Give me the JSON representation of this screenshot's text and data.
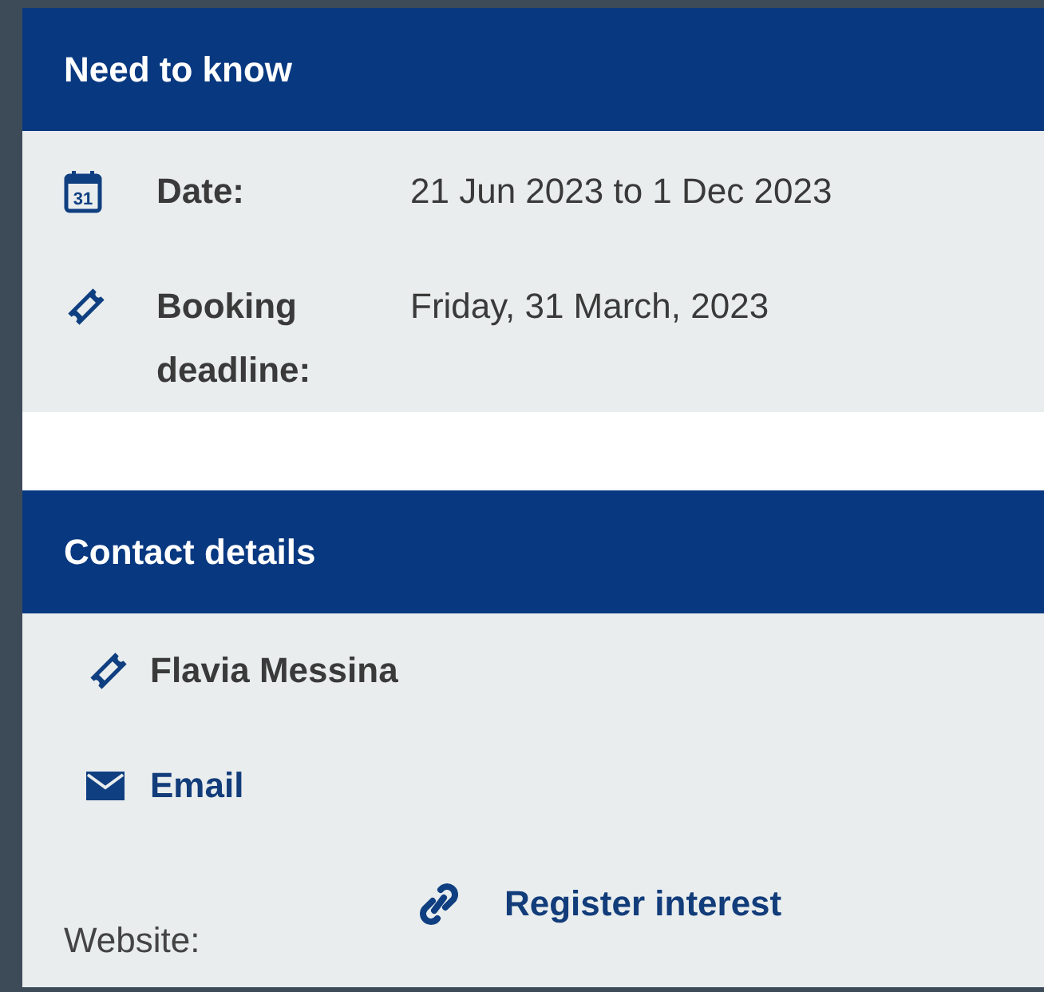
{
  "need_to_know": {
    "title": "Need to know",
    "rows": [
      {
        "kind": "calendar",
        "day": "31",
        "label": "Date:",
        "value": "21 Jun 2023 to 1 Dec 2023"
      },
      {
        "kind": "ticket",
        "label": "Booking deadline:",
        "value": "Friday, 31 March, 2023"
      }
    ]
  },
  "contact": {
    "title": "Contact details",
    "name": "Flavia Messina",
    "email": "Email",
    "website_label": "Website:",
    "website_link": "Register interest"
  }
}
